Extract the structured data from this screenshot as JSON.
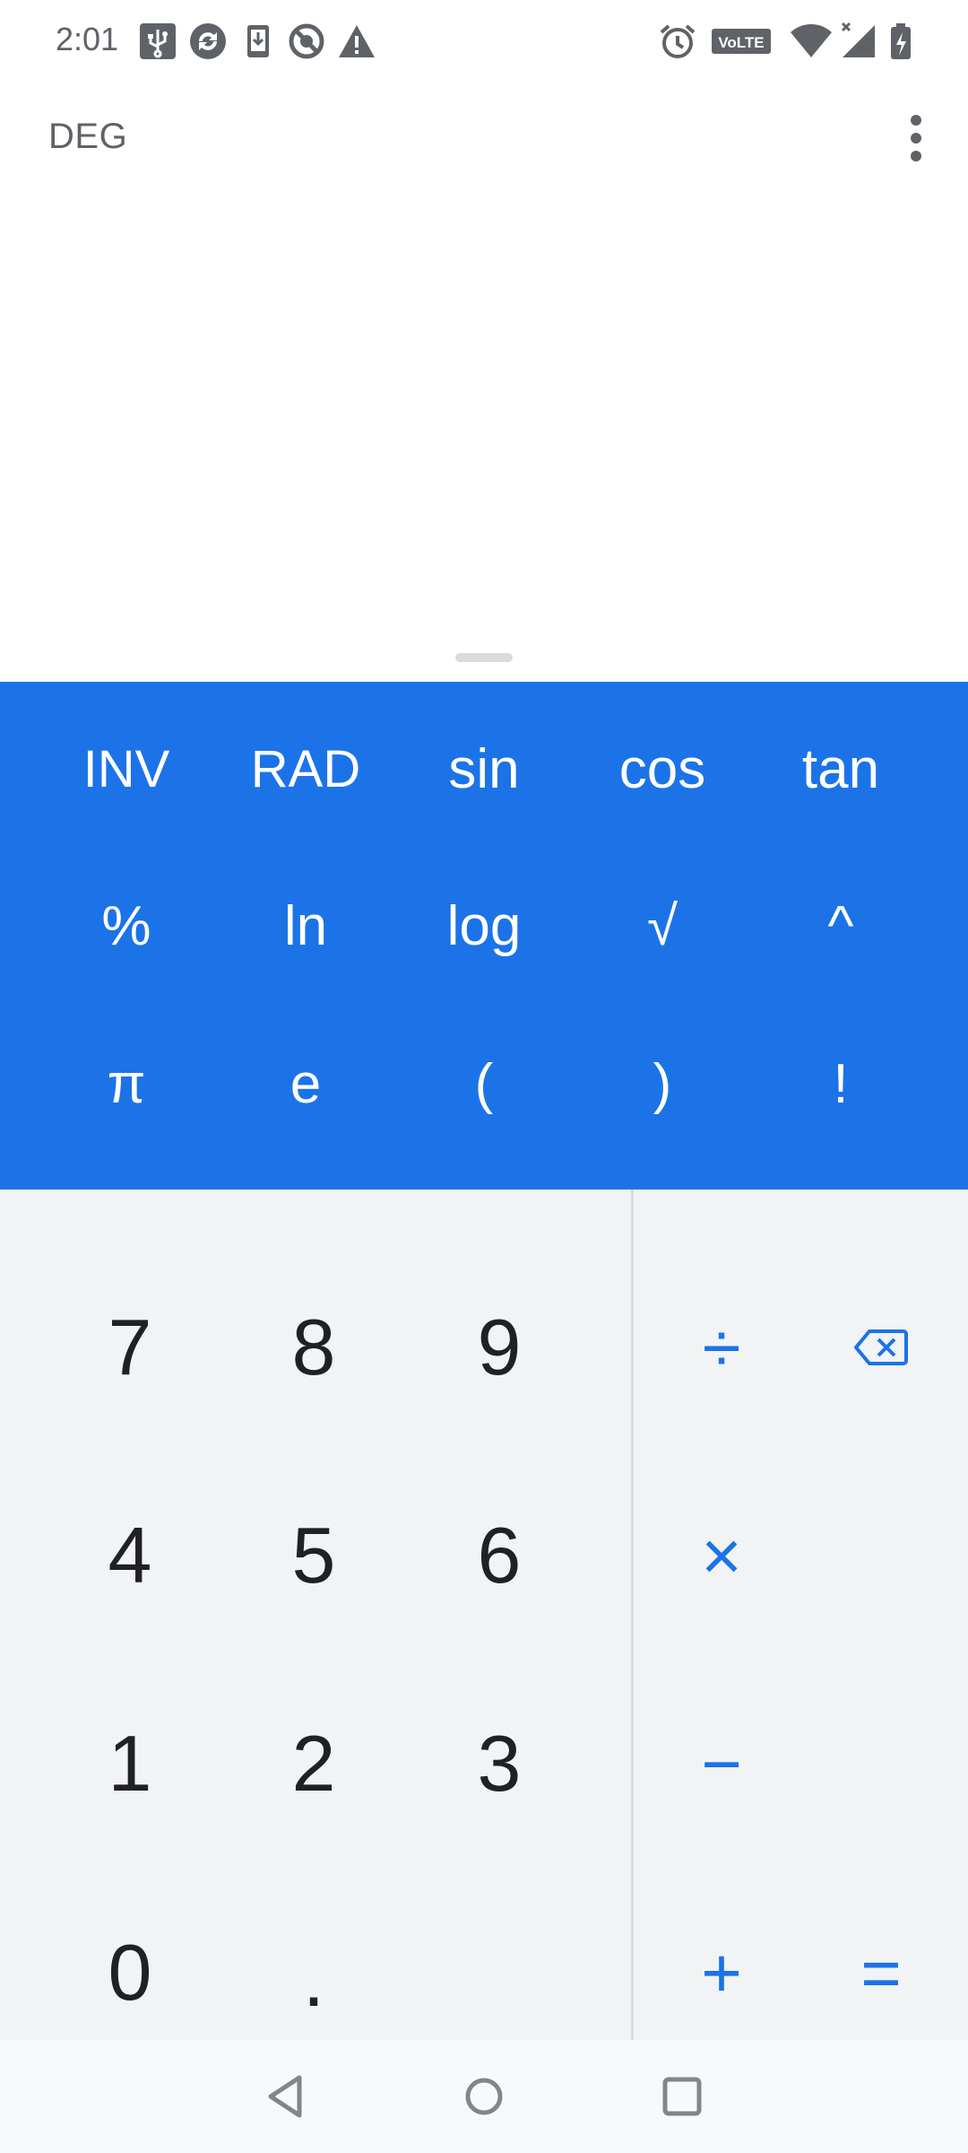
{
  "status_bar": {
    "time": "2:01",
    "volte_label": "VoLTE",
    "left_icons": [
      "usb-icon",
      "sync-icon",
      "download-icon",
      "do-not-disturb-icon",
      "warning-icon"
    ],
    "right_icons": [
      "alarm-icon",
      "volte-icon",
      "wifi-icon",
      "signal-icon",
      "battery-charging-icon"
    ]
  },
  "app_bar": {
    "angle_mode": "DEG",
    "menu_icon": "more-vert-icon"
  },
  "display": {
    "expression": "",
    "result": ""
  },
  "scientific": {
    "row1": [
      "INV",
      "RAD",
      "sin",
      "cos",
      "tan"
    ],
    "row2": [
      "%",
      "ln",
      "log",
      "√",
      "^"
    ],
    "row3": [
      "π",
      "e",
      "(",
      ")",
      "!"
    ]
  },
  "numpad": {
    "row1": [
      "7",
      "8",
      "9"
    ],
    "row2": [
      "4",
      "5",
      "6"
    ],
    "row3": [
      "1",
      "2",
      "3"
    ],
    "row4": [
      "0",
      "."
    ]
  },
  "operators": {
    "divide": "÷",
    "multiply": "×",
    "minus": "−",
    "plus": "+",
    "equals": "=",
    "backspace_icon": "backspace-icon"
  },
  "nav_bar": {
    "icons": [
      "back-icon",
      "home-icon",
      "recents-icon"
    ]
  },
  "colors": {
    "accent": "#1c73e8",
    "operator_text": "#1a73e8",
    "pad_background": "#f1f3f4",
    "digit_text": "#202124",
    "secondary_text": "#5f6368"
  }
}
